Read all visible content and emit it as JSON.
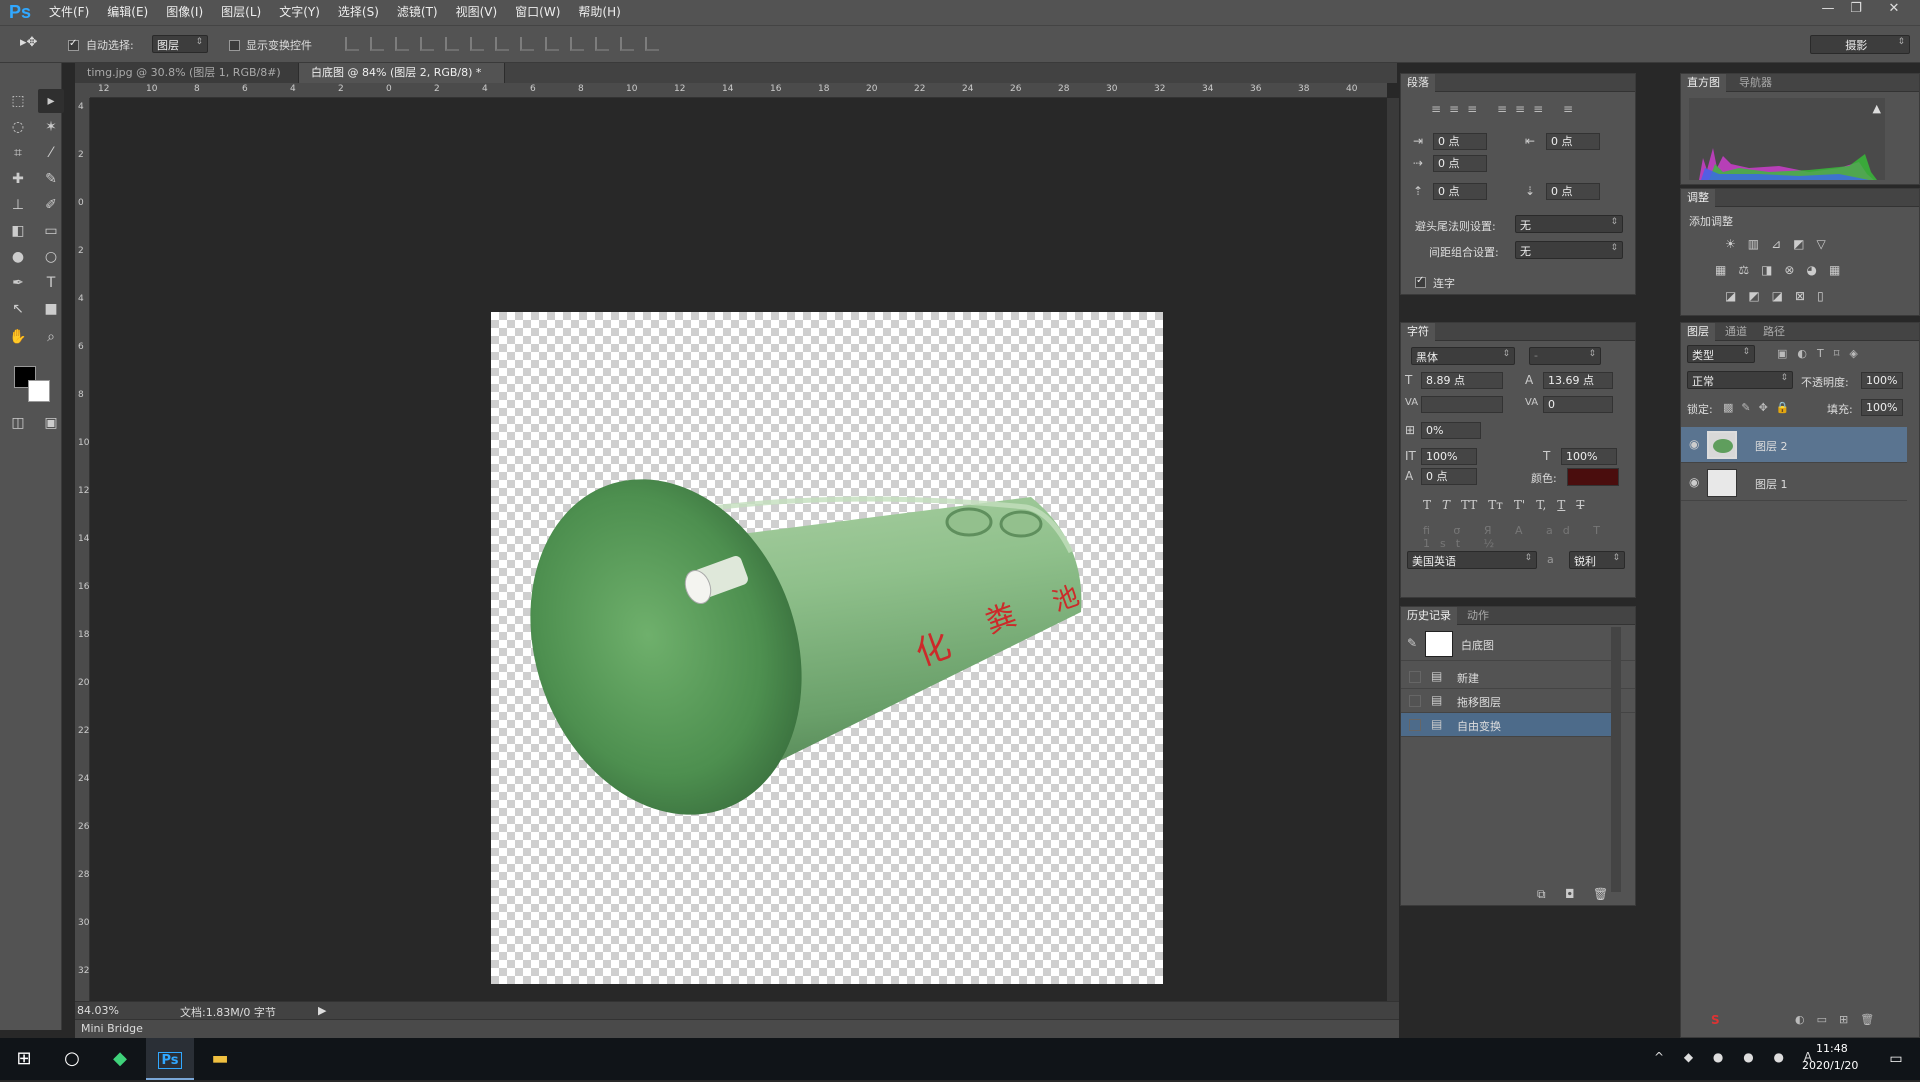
{
  "app": {
    "logo": "Ps"
  },
  "menu": [
    "文件(F)",
    "编辑(E)",
    "图像(I)",
    "图层(L)",
    "文字(Y)",
    "选择(S)",
    "滤镜(T)",
    "视图(V)",
    "窗口(W)",
    "帮助(H)"
  ],
  "options": {
    "auto_select_label": "自动选择:",
    "auto_select_value": "图层",
    "show_transform_label": "显示变换控件",
    "workspace": "摄影"
  },
  "tabs": [
    {
      "label": "timg.jpg @ 30.8% (图层 1, RGB/8#) *"
    },
    {
      "label": "白底图 @ 84% (图层 2, RGB/8) *"
    }
  ],
  "ruler_top": [
    "12",
    "10",
    "8",
    "6",
    "4",
    "2",
    "0",
    "2",
    "4",
    "6",
    "8",
    "10",
    "12",
    "14",
    "16",
    "18",
    "20",
    "22",
    "24",
    "26",
    "28",
    "30",
    "32",
    "34",
    "36",
    "38",
    "40"
  ],
  "ruler_left": [
    "4",
    "2",
    "0",
    "2",
    "4",
    "6",
    "8",
    "10",
    "12",
    "14",
    "16",
    "18",
    "20",
    "22",
    "24",
    "26",
    "28",
    "30",
    "32"
  ],
  "canvas": {
    "tank_text": [
      "化",
      "粪",
      "池"
    ]
  },
  "status": {
    "zoom": "84.03%",
    "doc": "文档:1.83M/0 字节"
  },
  "mini_bridge": "Mini Bridge",
  "paragraph": {
    "tab": "段落",
    "indent_left": "0 点",
    "indent_right": "0 点",
    "indent_first": "0 点",
    "space_before": "0 点",
    "space_after": "0 点",
    "kinsoku_label": "避头尾法则设置:",
    "kinsoku_value": "无",
    "mojikumi_label": "间距组合设置:",
    "mojikumi_value": "无",
    "hyphenate_label": "连字"
  },
  "character": {
    "tab": "字符",
    "font": "黑体",
    "style": "-",
    "size": "8.89 点",
    "leading": "13.69 点",
    "tracking": "0",
    "scale_pct": "0%",
    "vscale": "100%",
    "hscale": "100%",
    "baseline": "0 点",
    "color_label": "颜色:",
    "color": "#4a0d0d",
    "type_buttons": [
      "T",
      "T",
      "TT",
      "Tт",
      "T'",
      "T,",
      "T",
      "T"
    ],
    "language": "美国英语",
    "aa_label": "a",
    "aa_value": "锐利"
  },
  "history": {
    "tabs": [
      "历史记录",
      "动作"
    ],
    "snapshot": "白底图",
    "items": [
      "新建",
      "拖移图层",
      "自由变换"
    ],
    "selected_index": 2
  },
  "histogram": {
    "tabs": [
      "直方图",
      "导航器"
    ]
  },
  "adjustments": {
    "tab": "调整",
    "title": "添加调整"
  },
  "layers": {
    "tabs": [
      "图层",
      "通道",
      "路径"
    ],
    "filter": "类型",
    "blend": "正常",
    "opacity_label": "不透明度:",
    "opacity": "100%",
    "lock_label": "锁定:",
    "fill_label": "填充:",
    "fill": "100%",
    "items": [
      {
        "name": "图层 2",
        "selected": true
      },
      {
        "name": "图层 1",
        "selected": false
      }
    ]
  },
  "taskbar": {
    "time": "11:48",
    "date": "2020/1/20"
  }
}
